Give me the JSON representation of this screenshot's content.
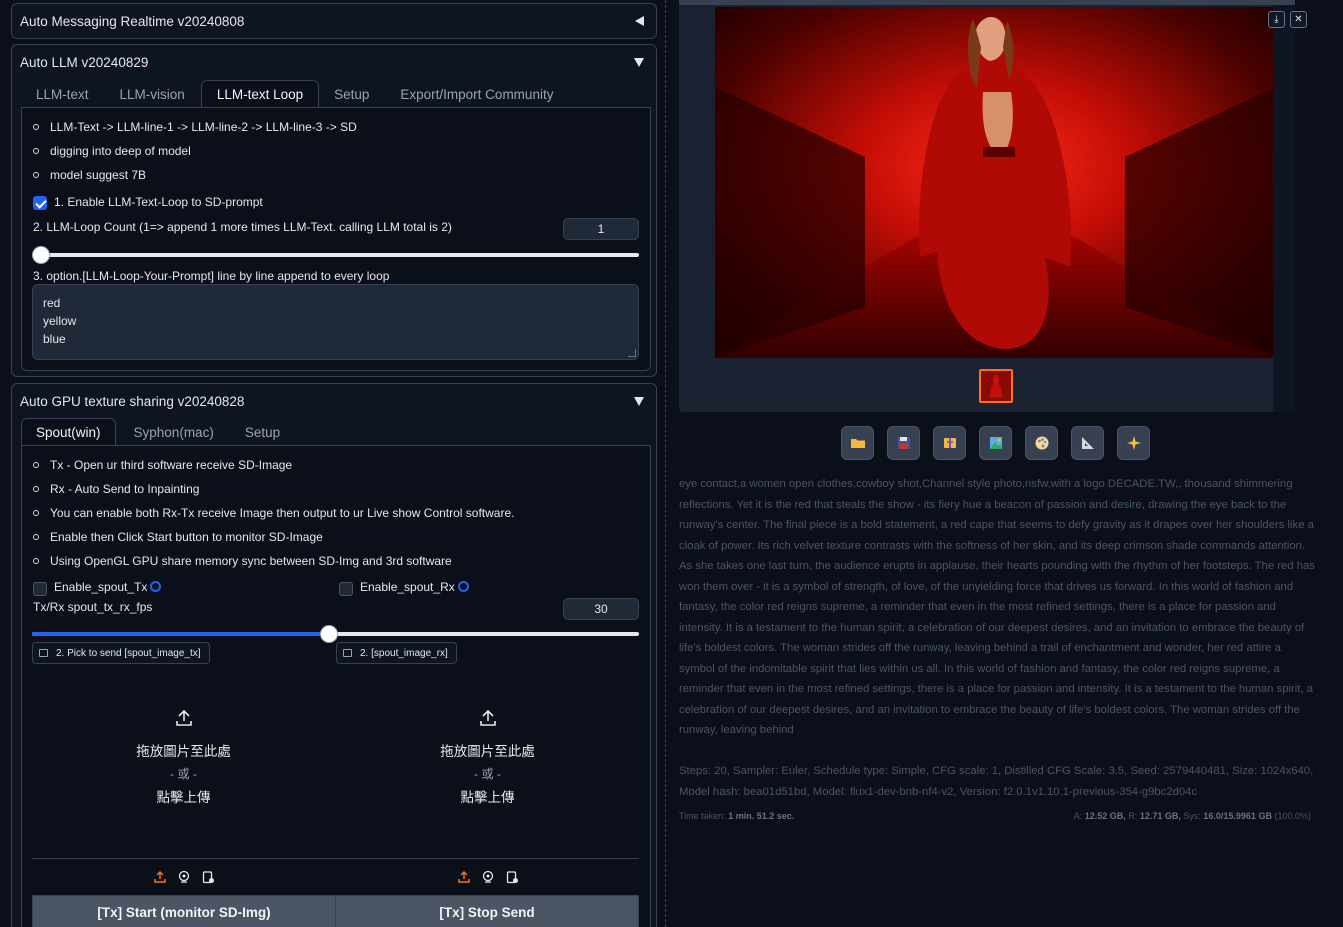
{
  "auto_messaging": {
    "title": "Auto Messaging Realtime v20240808"
  },
  "auto_llm": {
    "title": "Auto LLM v20240829",
    "tabs": [
      {
        "label": "LLM-text"
      },
      {
        "label": "LLM-vision"
      },
      {
        "label": "LLM-text Loop"
      },
      {
        "label": "Setup"
      },
      {
        "label": "Export/Import Community"
      }
    ],
    "active_tab": "LLM-text Loop",
    "bullets": [
      "LLM-Text -> LLM-line-1 -> LLM-line-2 -> LLM-line-3 -> SD",
      "digging into deep of model",
      "model suggest 7B"
    ],
    "enable_loop_label": "1. Enable LLM-Text-Loop to SD-prompt",
    "enable_loop_checked": true,
    "loop_count_label": "2. LLM-Loop Count (1=> append 1 more times LLM-Text. calling LLM total is 2)",
    "loop_count_value": "1",
    "loop_count_fraction": 0.0,
    "loop_prompt_label": "3. option.[LLM-Loop-Your-Prompt] line by line append to every loop",
    "loop_prompt_lines": [
      "red",
      "yellow",
      "blue"
    ]
  },
  "gpu_sharing": {
    "title": "Auto GPU texture sharing v20240828",
    "tabs": [
      {
        "label": "Spout(win)"
      },
      {
        "label": "Syphon(mac)"
      },
      {
        "label": "Setup"
      }
    ],
    "active_tab": "Spout(win)",
    "bullets": [
      "Tx - Open ur third software receive SD-Image",
      "Rx - Auto Send to Inpainting",
      "You can enable both Rx-Tx receive Image then output to ur Live show Control software.",
      "Enable then Click Start button to monitor SD-Image",
      "Using OpenGL GPU share memory sync between SD-Img and 3rd software"
    ],
    "enable_tx_label": "Enable_spout_Tx",
    "enable_rx_label": "Enable_spout_Rx",
    "fps_label": "Tx/Rx spout_tx_rx_fps",
    "fps_value": "30",
    "fps_fraction": 0.49,
    "tx_image_label": "2. Pick to send [spout_image_tx]",
    "rx_image_label": "2. [spout_image_rx]",
    "drop_text": "拖放圖片至此處",
    "drop_or": "- 或 -",
    "drop_click": "點擊上傳",
    "tx_start_button": "[Tx] Start (monitor SD-Img)",
    "tx_stop_button": "[Tx] Stop Send"
  },
  "output": {
    "generation_info": "eye contact,a women open clothes,cowboy shot,Channel style photo,nsfw,with a logo DECADE.TW,, thousand shimmering reflections. Yet it is the red that steals the show - its fiery hue a beacon of passion and desire, drawing the eye back to the runway's center. The final piece is a bold statement, a red cape that seems to defy gravity as it drapes over her shoulders like a cloak of power. Its rich velvet texture contrasts with the softness of her skin, and its deep crimson shade commands attention. As she takes one last turn, the audience erupts in applause, their hearts pounding with the rhythm of her footsteps. The red has won them over - it is a symbol of strength, of love, of the unyielding force that drives us forward. In this world of fashion and fantasy, the color red reigns supreme, a reminder that even in the most refined settings, there is a place for passion and intensity. It is a testament to the human spirit, a celebration of our deepest desires, and an invitation to embrace the beauty of life's boldest colors. The woman strides off the runway, leaving behind a trail of enchantment and wonder, her red attire a symbol of the indomitable spirit that lies within us all. In this world of fashion and fantasy, the color red reigns supreme, a reminder that even in the most refined settings, there is a place for passion and intensity. It is a testament to the human spirit, a celebration of our deepest desires, and an invitation to embrace the beauty of life's boldest colors. The woman strides off the runway, leaving behind",
    "params": "Steps: 20, Sampler: Euler, Schedule type: Simple, CFG scale: 1, Distilled CFG Scale: 3.5, Seed: 2579440481, Size: 1024x640, Model hash: bea01d51bd, Model: flux1-dev-bnb-nf4-v2, Version: f2.0.1v1.10.1-previous-354-g9bc2d04c",
    "time_label": "Time taken:",
    "time_value": "1 min. 51.2 sec.",
    "vram_a_label": "A:",
    "vram_a": "12.52 GB,",
    "vram_r_label": "R:",
    "vram_r": "12.71 GB,",
    "vram_sys_label": "Sys:",
    "vram_sys": "16.0/15.9961 GB",
    "vram_pct": "(100.0%)",
    "toolbar_icons": [
      "folder-icon",
      "save-icon",
      "zip-icon",
      "image-icon",
      "palette-icon",
      "ruler-icon",
      "sparkle-icon"
    ]
  },
  "colors": {
    "accent": "#2563eb",
    "highlight": "#f97316",
    "panel": "#0f1422",
    "background": "#0b0f19"
  }
}
